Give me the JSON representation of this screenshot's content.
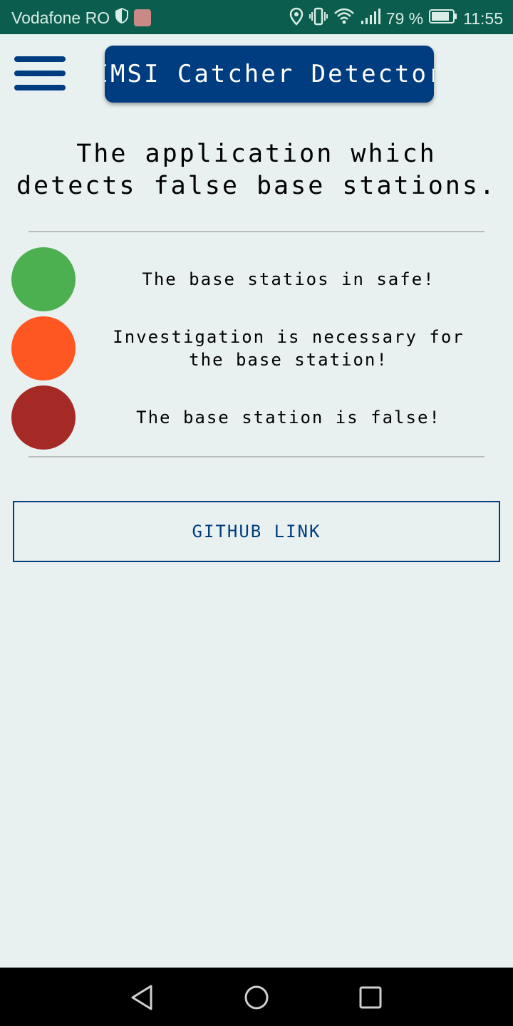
{
  "status_bar": {
    "carrier": "Vodafone RO",
    "battery": "79 %",
    "time": "11:55",
    "icons": [
      "shield-icon",
      "huawei-app-icon",
      "location-icon",
      "vibrate-icon",
      "wifi-icon",
      "signal-icon",
      "battery-icon"
    ]
  },
  "header": {
    "menu_icon": "hamburger-menu-icon",
    "title": "IMSI Catcher Detector"
  },
  "main": {
    "tagline": "The application which detects false base stations.",
    "legend": [
      {
        "color": "#4caf50",
        "label": "The base statios in safe!"
      },
      {
        "color": "#ff5722",
        "label": "Investigation is necessary for the base station!"
      },
      {
        "color": "#a52a25",
        "label": "The base station is false!"
      }
    ],
    "github_button": "GITHUB LINK"
  },
  "nav_bar": {
    "icons": [
      "back-icon",
      "home-icon",
      "recent-apps-icon"
    ]
  },
  "colors": {
    "primary": "#003d80",
    "status_bar": "#0b5e4e",
    "background": "#e8f1f0"
  }
}
